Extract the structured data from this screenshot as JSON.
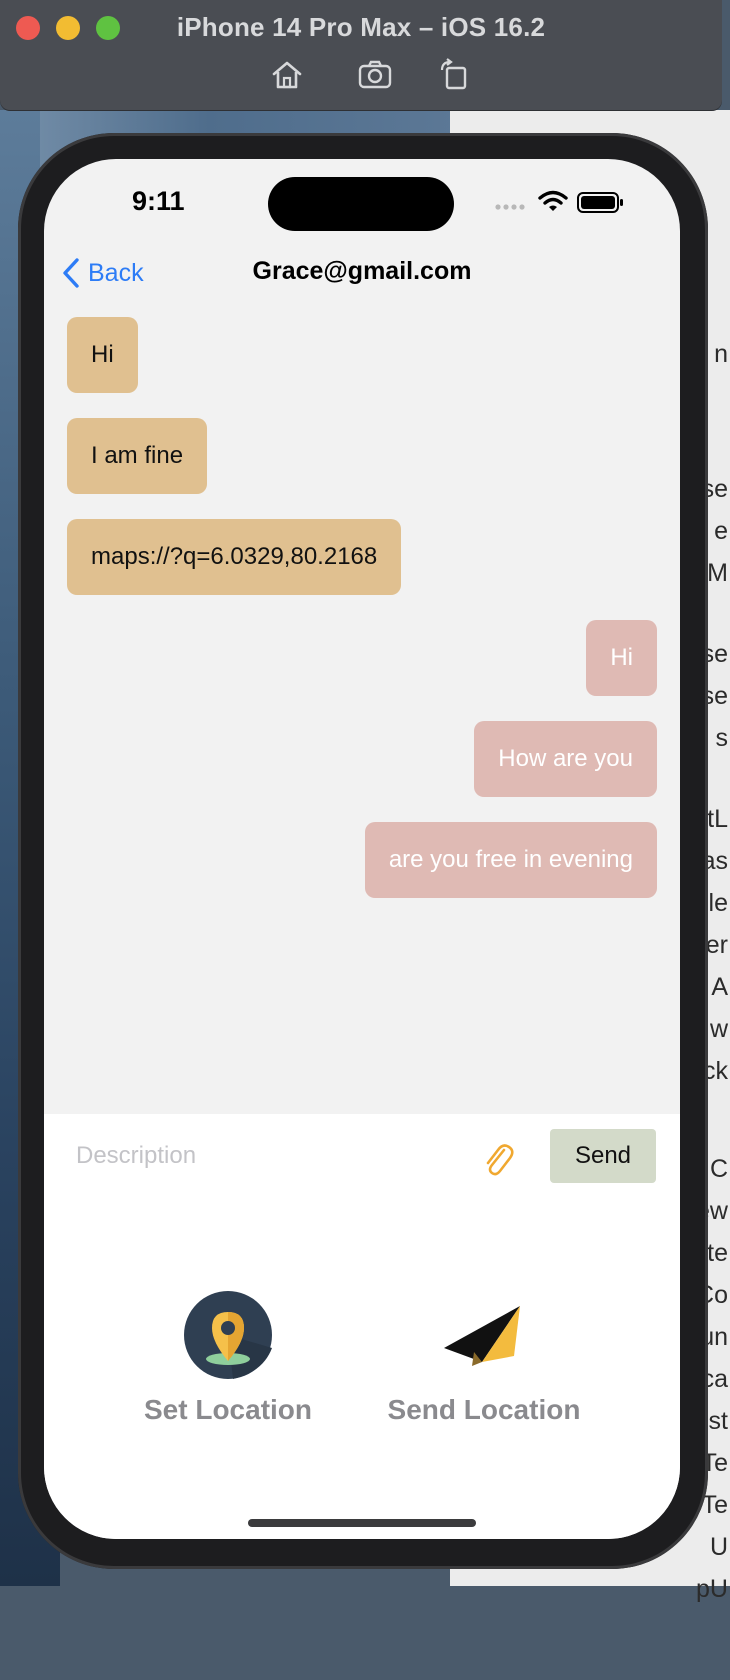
{
  "simulator": {
    "title": "iPhone 14 Pro Max – iOS 16.2",
    "toolbar_icons": [
      "home-icon",
      "screenshot-icon",
      "rotate-icon"
    ]
  },
  "status_bar": {
    "time": "9:11"
  },
  "nav": {
    "back_label": "Back",
    "title": "Grace@gmail.com"
  },
  "messages": {
    "incoming": [
      "Hi",
      "I am fine",
      "maps://?q=6.0329,80.2168"
    ],
    "outgoing": [
      "Hi",
      "How are you",
      "are you free in evening"
    ]
  },
  "compose": {
    "placeholder": "Description",
    "value": "",
    "send_label": "Send"
  },
  "actions": {
    "set_location_label": "Set Location",
    "send_location_label": "Send Location"
  },
  "background_code_letters": [
    "n",
    "se",
    "e",
    "tM",
    "se",
    "se",
    "s",
    "tL",
    "as",
    "le",
    "er",
    "A",
    "w",
    "ck",
    "C",
    "ew",
    "te",
    "Co",
    "un",
    "ca",
    "st",
    "Te",
    "Te",
    "U",
    "pU"
  ],
  "colors": {
    "incoming_bubble": "#e0c090",
    "outgoing_bubble": "#dfbab4",
    "send_button": "#d3dac9",
    "link_blue": "#2d7cf6",
    "clip_orange": "#f0a830"
  }
}
